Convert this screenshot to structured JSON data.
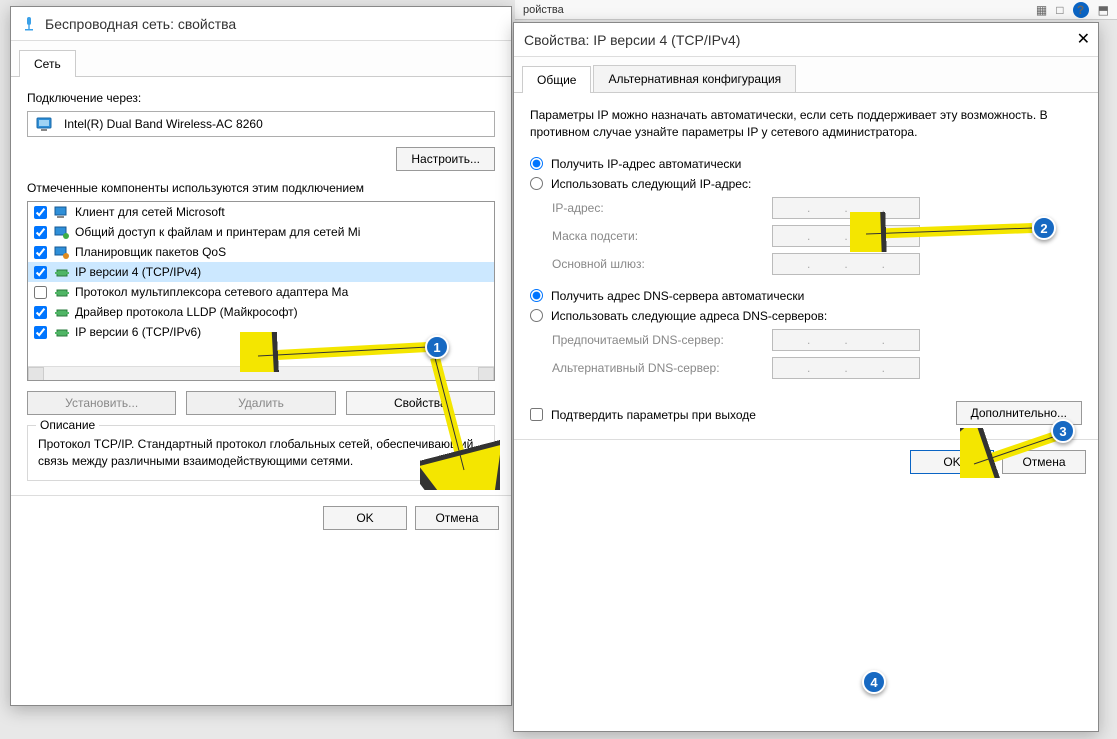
{
  "taskbar": {
    "fragment": "ройства",
    "help": "?"
  },
  "left_window": {
    "title": "Беспроводная сеть: свойства",
    "tab_network": "Сеть",
    "connect_via_label": "Подключение через:",
    "adapter_name": "Intel(R) Dual Band Wireless-AC 8260",
    "configure_btn": "Настроить...",
    "components_label": "Отмеченные компоненты используются этим подключением",
    "components": [
      {
        "checked": true,
        "label": "Клиент для сетей Microsoft",
        "icon": "client"
      },
      {
        "checked": true,
        "label": "Общий доступ к файлам и принтерам для сетей Mi",
        "icon": "share"
      },
      {
        "checked": true,
        "label": "Планировщик пакетов QoS",
        "icon": "qos"
      },
      {
        "checked": true,
        "label": "IP версии 4 (TCP/IPv4)",
        "icon": "proto",
        "highlight": true
      },
      {
        "checked": false,
        "label": "Протокол мультиплексора сетевого адаптера Ма",
        "icon": "proto"
      },
      {
        "checked": true,
        "label": "Драйвер протокола LLDP (Майкрософт)",
        "icon": "proto"
      },
      {
        "checked": true,
        "label": "IP версии 6 (TCP/IPv6)",
        "icon": "proto"
      }
    ],
    "install_btn": "Установить...",
    "uninstall_btn": "Удалить",
    "properties_btn": "Свойства",
    "description_title": "Описание",
    "description_text": "Протокол TCP/IP. Стандартный протокол глобальных сетей, обеспечивающий связь между различными взаимодействующими сетями.",
    "ok_btn": "OK",
    "cancel_btn": "Отмена"
  },
  "right_window": {
    "title": "Свойства: IP версии 4 (TCP/IPv4)",
    "tab_general": "Общие",
    "tab_alt": "Альтернативная конфигурация",
    "info_text": "Параметры IP можно назначать автоматически, если сеть поддерживает эту возможность. В противном случае узнайте параметры IP у сетевого администратора.",
    "ip_auto": "Получить IP-адрес автоматически",
    "ip_manual": "Использовать следующий IP-адрес:",
    "ip_address_label": "IP-адрес:",
    "subnet_label": "Маска подсети:",
    "gateway_label": "Основной шлюз:",
    "dns_auto": "Получить адрес DNS-сервера автоматически",
    "dns_manual": "Использовать следующие адреса DNS-серверов:",
    "dns_pref_label": "Предпочитаемый DNS-сервер:",
    "dns_alt_label": "Альтернативный DNS-сервер:",
    "validate_label": "Подтвердить параметры при выходе",
    "advanced_btn": "Дополнительно...",
    "ok_btn": "OK",
    "cancel_btn": "Отмена"
  },
  "callouts": {
    "c1": "1",
    "c2": "2",
    "c3": "3",
    "c4": "4"
  }
}
